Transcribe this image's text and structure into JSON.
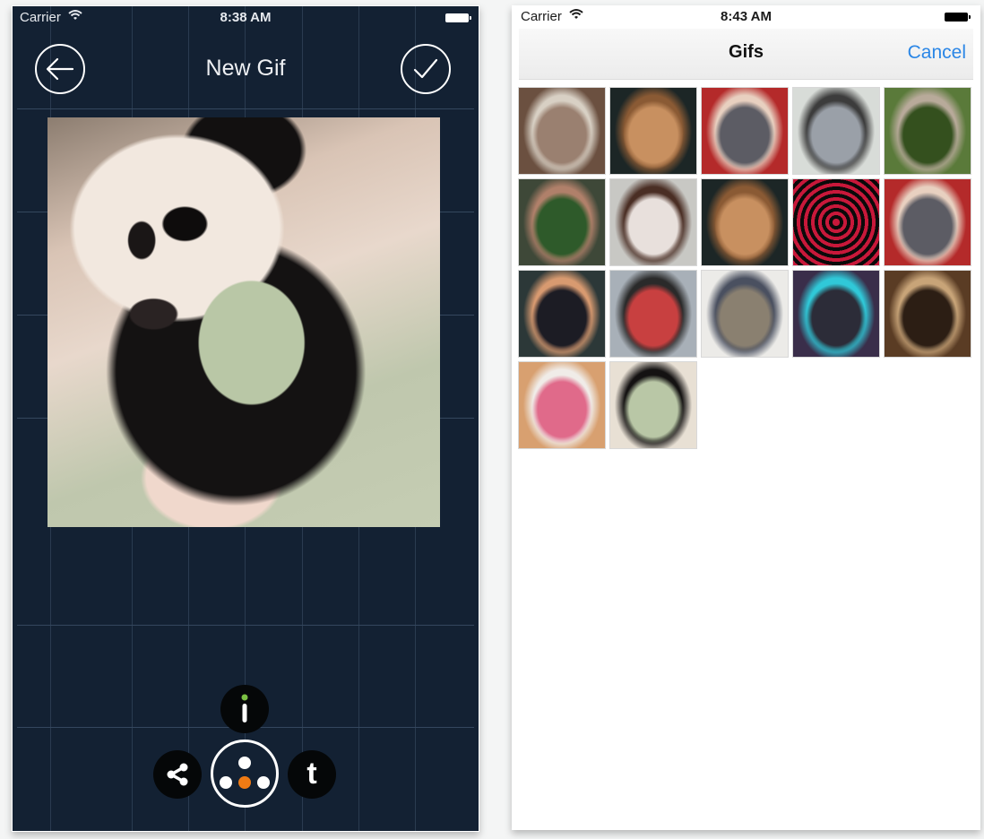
{
  "left_screen": {
    "status_bar": {
      "carrier": "Carrier",
      "time": "8:38 AM",
      "wifi_icon": "wifi-icon",
      "battery_icon": "battery-full-icon"
    },
    "nav": {
      "title": "New Gif",
      "back_icon": "arrow-left-circle-icon",
      "confirm_icon": "checkmark-circle-icon"
    },
    "preview": {
      "description": "Baby panda holding a green ball"
    },
    "action_menu": {
      "info": {
        "icon": "info-icon",
        "label": "i",
        "accent": "#7bc043"
      },
      "share": {
        "icon": "share-icon"
      },
      "menu": {
        "icon": "dots-menu-icon",
        "accent": "#f07b14"
      },
      "tumblr": {
        "icon": "tumblr-icon",
        "label": "t"
      }
    },
    "colors": {
      "background": "#132133",
      "grid_line": "#34475e"
    }
  },
  "right_screen": {
    "status_bar": {
      "carrier": "Carrier",
      "time": "8:43 AM",
      "wifi_icon": "wifi-icon",
      "battery_icon": "battery-full-icon"
    },
    "nav": {
      "title": "Gifs",
      "cancel_label": "Cancel",
      "accent": "#2a86e6"
    },
    "gifs": [
      {
        "name": "boy-at-table",
        "colors": [
          "#6b5040",
          "#d8d0c4",
          "#9a8070"
        ]
      },
      {
        "name": "fluffy-dog-dark",
        "colors": [
          "#1c2626",
          "#8a5a34",
          "#c89060"
        ]
      },
      {
        "name": "girl-clapping-red",
        "colors": [
          "#b42a2a",
          "#e8d0c0",
          "#5c5c64"
        ]
      },
      {
        "name": "puppies-on-blanket",
        "colors": [
          "#d8dcd8",
          "#3c3c3c",
          "#9aa0a8"
        ]
      },
      {
        "name": "bird-in-grass",
        "colors": [
          "#5a7a3a",
          "#b8aa9a",
          "#34501e"
        ]
      },
      {
        "name": "person-water-bottle",
        "colors": [
          "#3e4838",
          "#b0806a",
          "#2e5a2a"
        ]
      },
      {
        "name": "boxer-dog-sitting",
        "colors": [
          "#c8c8c4",
          "#4a2e24",
          "#e8e0dc"
        ]
      },
      {
        "name": "fluffy-dog-dark-2",
        "colors": [
          "#1c2626",
          "#8a5a34",
          "#c89060"
        ]
      },
      {
        "name": "red-spiral",
        "colors": [
          "#c8183a",
          "#0a0a0a",
          "#c8183a"
        ]
      },
      {
        "name": "girl-clapping-red-2",
        "colors": [
          "#b42a2a",
          "#e8d0c0",
          "#5c5c64"
        ]
      },
      {
        "name": "mind-blown-man",
        "colors": [
          "#2c3838",
          "#d89a70",
          "#1c1c24"
        ]
      },
      {
        "name": "dancing-crowd",
        "colors": [
          "#a8b0b8",
          "#2a2a2a",
          "#c84040"
        ]
      },
      {
        "name": "cat-crouching",
        "colors": [
          "#ecebe8",
          "#4a5060",
          "#8a8070"
        ]
      },
      {
        "name": "man-on-stage",
        "colors": [
          "#3a2e4a",
          "#30c8d8",
          "#2c2c38"
        ]
      },
      {
        "name": "kid-kicking-door",
        "colors": [
          "#5a3c24",
          "#c8a478",
          "#2c1e14"
        ]
      },
      {
        "name": "fox-tongue",
        "colors": [
          "#d8a070",
          "#f0ece8",
          "#e06a8a"
        ]
      },
      {
        "name": "panda-ball",
        "colors": [
          "#e8e0d4",
          "#141212",
          "#b9c7a6"
        ]
      }
    ]
  }
}
